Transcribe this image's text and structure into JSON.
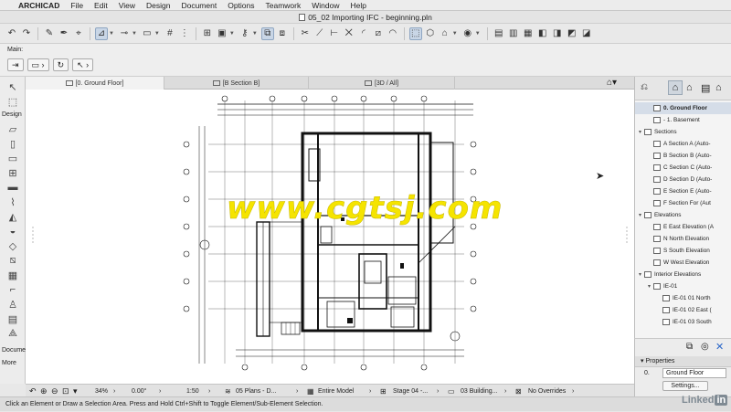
{
  "menubar": {
    "apple_icon": "apple-icon",
    "items": [
      "ARCHICAD",
      "File",
      "Edit",
      "View",
      "Design",
      "Document",
      "Options",
      "Teamwork",
      "Window",
      "Help"
    ]
  },
  "window": {
    "title": "05_02 Importing IFC - beginning.pln"
  },
  "infobox": {
    "label": "Main:"
  },
  "toolbox": {
    "sections": [
      "Design",
      "Docume",
      "More"
    ],
    "tools": [
      "arrow-tool",
      "marquee-tool",
      "wall-tool",
      "column-tool",
      "beam-tool",
      "slab-tool",
      "stair-tool",
      "railing-tool",
      "roof-tool",
      "shell-tool",
      "skylight-tool",
      "curtain-wall-tool",
      "door-tool",
      "window-tool",
      "object-tool",
      "zone-tool",
      "mesh-tool",
      "morph-tool"
    ]
  },
  "tabs": [
    {
      "label": "[0. Ground Floor]",
      "active": true
    },
    {
      "label": "[B Section B]",
      "active": false
    },
    {
      "label": "[3D / All]",
      "active": false
    }
  ],
  "watermark": "www.cgtsj.com",
  "navigator": {
    "items": [
      {
        "label": "0. Ground Floor",
        "level": 1,
        "selected": true,
        "expand": ""
      },
      {
        "label": "- 1. Basement",
        "level": 1,
        "selected": false,
        "expand": ""
      },
      {
        "label": "Sections",
        "level": 0,
        "selected": false,
        "expand": "▾"
      },
      {
        "label": "A Section A (Auto-",
        "level": 1,
        "selected": false,
        "expand": ""
      },
      {
        "label": "B Section B (Auto-",
        "level": 1,
        "selected": false,
        "expand": ""
      },
      {
        "label": "C Section C (Auto-",
        "level": 1,
        "selected": false,
        "expand": ""
      },
      {
        "label": "D Section D (Auto-",
        "level": 1,
        "selected": false,
        "expand": ""
      },
      {
        "label": "E Section E (Auto-",
        "level": 1,
        "selected": false,
        "expand": ""
      },
      {
        "label": "F Section For (Aut",
        "level": 1,
        "selected": false,
        "expand": ""
      },
      {
        "label": "Elevations",
        "level": 0,
        "selected": false,
        "expand": "▾"
      },
      {
        "label": "E East Elevation (A",
        "level": 1,
        "selected": false,
        "expand": ""
      },
      {
        "label": "N North Elevation",
        "level": 1,
        "selected": false,
        "expand": ""
      },
      {
        "label": "S South Elevation",
        "level": 1,
        "selected": false,
        "expand": ""
      },
      {
        "label": "W West Elevation",
        "level": 1,
        "selected": false,
        "expand": ""
      },
      {
        "label": "Interior Elevations",
        "level": 0,
        "selected": false,
        "expand": "▾"
      },
      {
        "label": "IE-01",
        "level": 1,
        "selected": false,
        "expand": "▾"
      },
      {
        "label": "IE-01 01 North",
        "level": 2,
        "selected": false,
        "expand": ""
      },
      {
        "label": "IE-01 02 East (",
        "level": 2,
        "selected": false,
        "expand": ""
      },
      {
        "label": "IE-01 03 South",
        "level": 2,
        "selected": false,
        "expand": ""
      }
    ]
  },
  "properties": {
    "header": "Properties",
    "number": "0.",
    "value": "Ground Floor",
    "settings_label": "Settings..."
  },
  "navbar": {
    "zoom": "34%",
    "angle": "0.00°",
    "scale": "1:50",
    "layer_combo": "05 Plans - D...",
    "model_view": "Entire Model",
    "renovation": "Stage 04 -...",
    "pen_set": "03 Building...",
    "overrides": "No Overrides"
  },
  "status": {
    "message": "Click an Element or Draw a Selection Area. Press and Hold Ctrl+Shift to Toggle Element/Sub-Element Selection."
  },
  "linkedin": {
    "text": "Linked",
    "in": "in"
  },
  "colors": {
    "selection_blue": "#d5dde8",
    "watermark_yellow": "#f5e400",
    "plan_line": "#111111"
  }
}
